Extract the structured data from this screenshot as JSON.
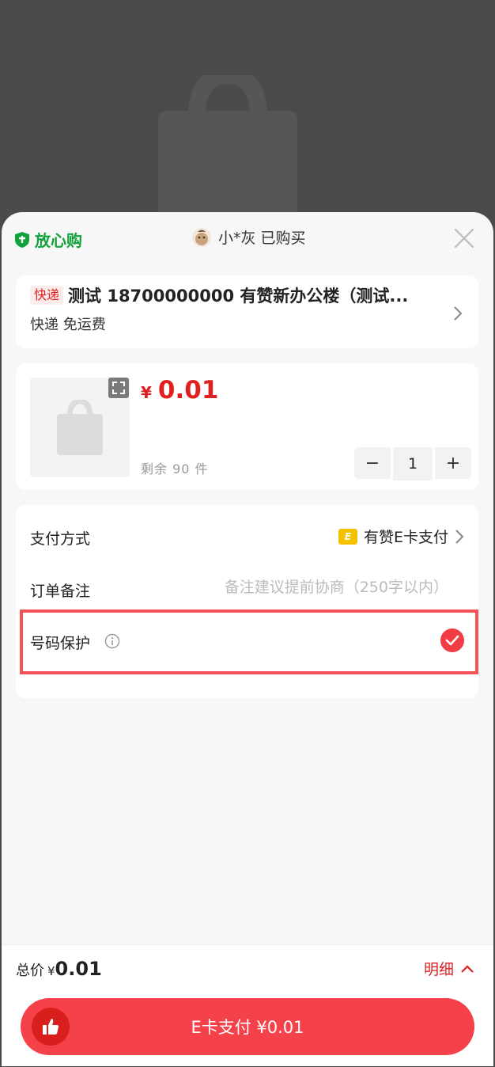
{
  "header": {
    "trust_label": "放心购",
    "buyer_text": "小*灰 已购买"
  },
  "address": {
    "tag": "快递",
    "text": "测试 18700000000 有赞新办公楼（测试...",
    "shipping": "快递 免运费"
  },
  "product": {
    "currency": "¥",
    "price": "0.01",
    "stock": "剩余 90 件",
    "quantity": "1",
    "minus": "−",
    "plus": "+"
  },
  "options": {
    "payment_label": "支付方式",
    "payment_icon_text": "E",
    "payment_value": "有赞E卡支付",
    "note_label": "订单备注",
    "note_placeholder": "备注建议提前协商（250字以内）",
    "privacy_label": "号码保护",
    "privacy_checked": true
  },
  "footer": {
    "total_label": "总价",
    "currency": "¥",
    "total_amount": "0.01",
    "detail_label": "明细",
    "pay_button": "E卡支付 ¥0.01"
  },
  "colors": {
    "accent": "#f5424a",
    "price": "#e02020",
    "trust": "#12a13a",
    "ecard": "#f5c200"
  },
  "icons": [
    "shopping-bag-icon",
    "shield-icon",
    "avatar",
    "close-icon",
    "chevron-right-icon",
    "expand-icon",
    "info-icon",
    "check-icon",
    "chevron-up-icon",
    "thumbs-up-icon"
  ]
}
